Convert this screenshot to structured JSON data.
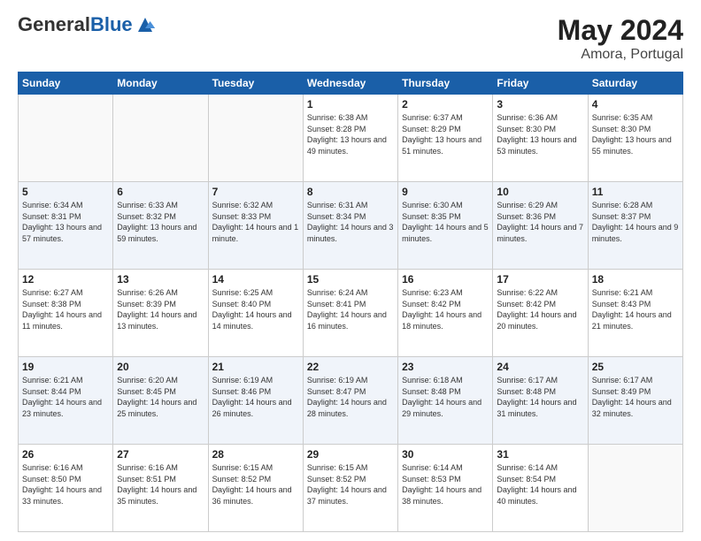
{
  "header": {
    "logo_general": "General",
    "logo_blue": "Blue",
    "month_title": "May 2024",
    "location": "Amora, Portugal"
  },
  "days_of_week": [
    "Sunday",
    "Monday",
    "Tuesday",
    "Wednesday",
    "Thursday",
    "Friday",
    "Saturday"
  ],
  "weeks": [
    [
      {
        "day": "",
        "info": ""
      },
      {
        "day": "",
        "info": ""
      },
      {
        "day": "",
        "info": ""
      },
      {
        "day": "1",
        "info": "Sunrise: 6:38 AM\nSunset: 8:28 PM\nDaylight: 13 hours\nand 49 minutes."
      },
      {
        "day": "2",
        "info": "Sunrise: 6:37 AM\nSunset: 8:29 PM\nDaylight: 13 hours\nand 51 minutes."
      },
      {
        "day": "3",
        "info": "Sunrise: 6:36 AM\nSunset: 8:30 PM\nDaylight: 13 hours\nand 53 minutes."
      },
      {
        "day": "4",
        "info": "Sunrise: 6:35 AM\nSunset: 8:30 PM\nDaylight: 13 hours\nand 55 minutes."
      }
    ],
    [
      {
        "day": "5",
        "info": "Sunrise: 6:34 AM\nSunset: 8:31 PM\nDaylight: 13 hours\nand 57 minutes."
      },
      {
        "day": "6",
        "info": "Sunrise: 6:33 AM\nSunset: 8:32 PM\nDaylight: 13 hours\nand 59 minutes."
      },
      {
        "day": "7",
        "info": "Sunrise: 6:32 AM\nSunset: 8:33 PM\nDaylight: 14 hours\nand 1 minute."
      },
      {
        "day": "8",
        "info": "Sunrise: 6:31 AM\nSunset: 8:34 PM\nDaylight: 14 hours\nand 3 minutes."
      },
      {
        "day": "9",
        "info": "Sunrise: 6:30 AM\nSunset: 8:35 PM\nDaylight: 14 hours\nand 5 minutes."
      },
      {
        "day": "10",
        "info": "Sunrise: 6:29 AM\nSunset: 8:36 PM\nDaylight: 14 hours\nand 7 minutes."
      },
      {
        "day": "11",
        "info": "Sunrise: 6:28 AM\nSunset: 8:37 PM\nDaylight: 14 hours\nand 9 minutes."
      }
    ],
    [
      {
        "day": "12",
        "info": "Sunrise: 6:27 AM\nSunset: 8:38 PM\nDaylight: 14 hours\nand 11 minutes."
      },
      {
        "day": "13",
        "info": "Sunrise: 6:26 AM\nSunset: 8:39 PM\nDaylight: 14 hours\nand 13 minutes."
      },
      {
        "day": "14",
        "info": "Sunrise: 6:25 AM\nSunset: 8:40 PM\nDaylight: 14 hours\nand 14 minutes."
      },
      {
        "day": "15",
        "info": "Sunrise: 6:24 AM\nSunset: 8:41 PM\nDaylight: 14 hours\nand 16 minutes."
      },
      {
        "day": "16",
        "info": "Sunrise: 6:23 AM\nSunset: 8:42 PM\nDaylight: 14 hours\nand 18 minutes."
      },
      {
        "day": "17",
        "info": "Sunrise: 6:22 AM\nSunset: 8:42 PM\nDaylight: 14 hours\nand 20 minutes."
      },
      {
        "day": "18",
        "info": "Sunrise: 6:21 AM\nSunset: 8:43 PM\nDaylight: 14 hours\nand 21 minutes."
      }
    ],
    [
      {
        "day": "19",
        "info": "Sunrise: 6:21 AM\nSunset: 8:44 PM\nDaylight: 14 hours\nand 23 minutes."
      },
      {
        "day": "20",
        "info": "Sunrise: 6:20 AM\nSunset: 8:45 PM\nDaylight: 14 hours\nand 25 minutes."
      },
      {
        "day": "21",
        "info": "Sunrise: 6:19 AM\nSunset: 8:46 PM\nDaylight: 14 hours\nand 26 minutes."
      },
      {
        "day": "22",
        "info": "Sunrise: 6:19 AM\nSunset: 8:47 PM\nDaylight: 14 hours\nand 28 minutes."
      },
      {
        "day": "23",
        "info": "Sunrise: 6:18 AM\nSunset: 8:48 PM\nDaylight: 14 hours\nand 29 minutes."
      },
      {
        "day": "24",
        "info": "Sunrise: 6:17 AM\nSunset: 8:48 PM\nDaylight: 14 hours\nand 31 minutes."
      },
      {
        "day": "25",
        "info": "Sunrise: 6:17 AM\nSunset: 8:49 PM\nDaylight: 14 hours\nand 32 minutes."
      }
    ],
    [
      {
        "day": "26",
        "info": "Sunrise: 6:16 AM\nSunset: 8:50 PM\nDaylight: 14 hours\nand 33 minutes."
      },
      {
        "day": "27",
        "info": "Sunrise: 6:16 AM\nSunset: 8:51 PM\nDaylight: 14 hours\nand 35 minutes."
      },
      {
        "day": "28",
        "info": "Sunrise: 6:15 AM\nSunset: 8:52 PM\nDaylight: 14 hours\nand 36 minutes."
      },
      {
        "day": "29",
        "info": "Sunrise: 6:15 AM\nSunset: 8:52 PM\nDaylight: 14 hours\nand 37 minutes."
      },
      {
        "day": "30",
        "info": "Sunrise: 6:14 AM\nSunset: 8:53 PM\nDaylight: 14 hours\nand 38 minutes."
      },
      {
        "day": "31",
        "info": "Sunrise: 6:14 AM\nSunset: 8:54 PM\nDaylight: 14 hours\nand 40 minutes."
      },
      {
        "day": "",
        "info": ""
      }
    ]
  ]
}
